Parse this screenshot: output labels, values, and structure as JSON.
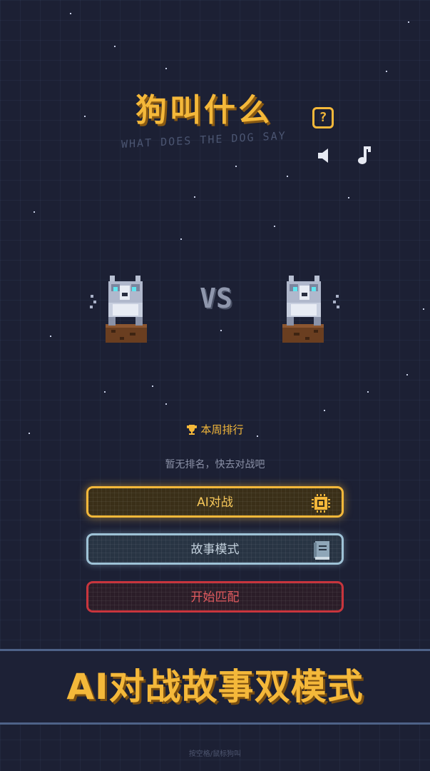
{
  "game": {
    "title": "狗叫什么",
    "subtitle": "WHAT DOES THE DOG SAY",
    "help_glyph": "?",
    "vs_label": "VS"
  },
  "icons": {
    "help": "help-icon",
    "sound": "speaker-icon",
    "music": "music-note-icon",
    "trophy": "trophy-icon",
    "chip": "chip-icon",
    "book": "book-icon"
  },
  "ranking": {
    "header": "本周排行",
    "empty_text": "暂无排名，快去对战吧"
  },
  "menu": {
    "ai_battle": "AI对战",
    "story_mode": "故事模式",
    "start_match": "开始匹配"
  },
  "banner": {
    "text": "AI对战故事双模式"
  },
  "footer": {
    "hint": "按空格/鼠标狗叫"
  },
  "colors": {
    "background": "#1c2034",
    "accent_gold": "#f4b83a",
    "story_blue": "#9ec2d6",
    "match_red": "#c8353d"
  }
}
